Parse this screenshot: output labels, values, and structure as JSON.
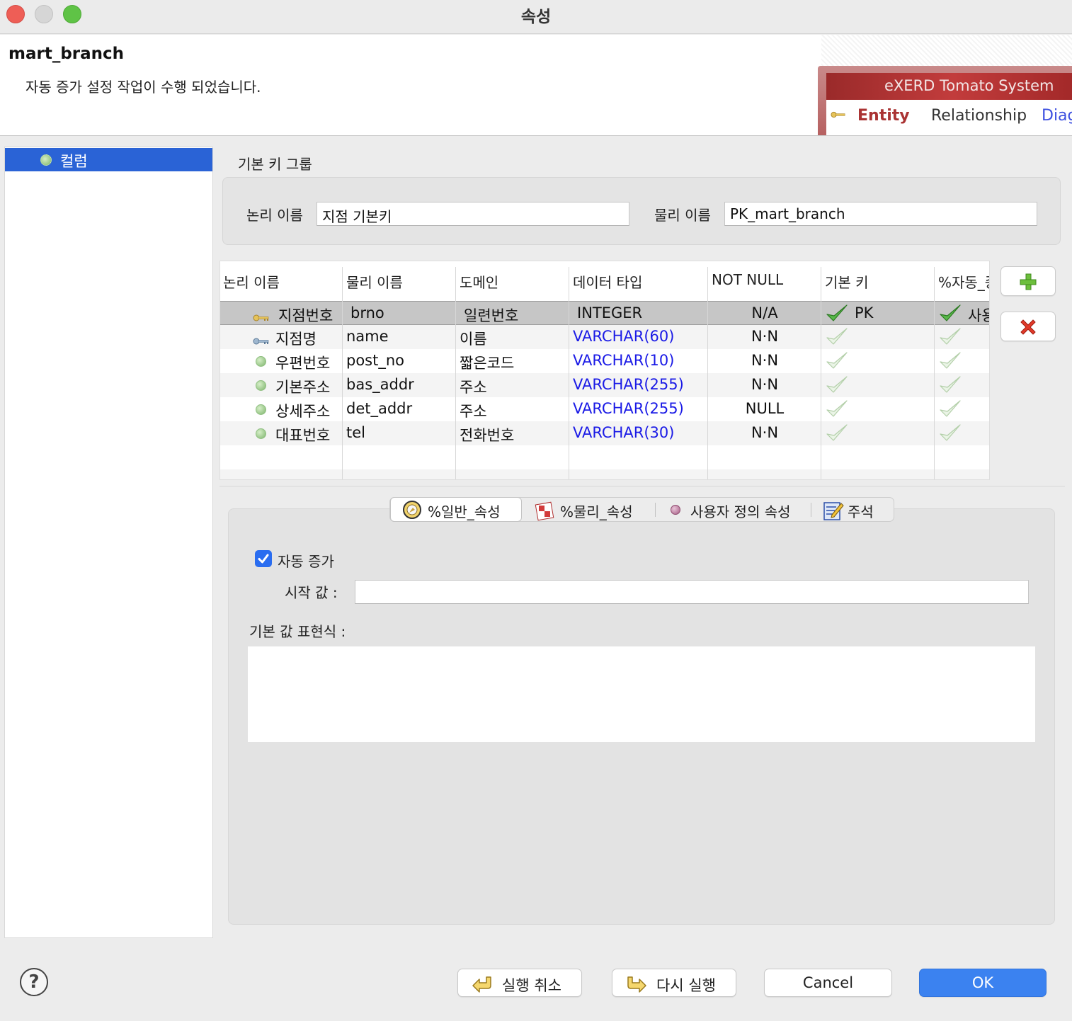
{
  "window": {
    "title": "속성"
  },
  "header": {
    "entity_name": "mart_branch",
    "message": "자동 증가 설정 작업이 수행 되었습니다.",
    "brand_title": "eXERD  Tomato System",
    "brand_tabs": [
      "Entity",
      "Relationship",
      "Diag"
    ]
  },
  "tree": {
    "items": [
      {
        "label": "컬럼",
        "icon": "column-icon"
      }
    ]
  },
  "pk_group": {
    "title": "기본 키 그룹",
    "logical_label": "논리 이름",
    "logical_value": "지점 기본키",
    "physical_label": "물리 이름",
    "physical_value": "PK_mart_branch"
  },
  "columns_table": {
    "headers": [
      "논리 이름",
      "물리 이름",
      "도메인",
      "데이터 타입",
      "NOT NULL",
      "기본 키",
      "%자동_증"
    ],
    "rows": [
      {
        "logical": "지점번호",
        "physical": "brno",
        "domain": "일련번호",
        "type": "INTEGER",
        "not_null": "N/A",
        "pk": "PK",
        "auto": "사용",
        "icon": "primary-key-icon",
        "selected": true
      },
      {
        "logical": "지점명",
        "physical": "name",
        "domain": "이름",
        "type": "VARCHAR(60)",
        "not_null": "N·N",
        "pk": "",
        "auto": "",
        "icon": "foreign-key-icon",
        "selected": false
      },
      {
        "logical": "우편번호",
        "physical": "post_no",
        "domain": "짧은코드",
        "type": "VARCHAR(10)",
        "not_null": "N·N",
        "pk": "",
        "auto": "",
        "icon": "column-dot-icon",
        "selected": false
      },
      {
        "logical": "기본주소",
        "physical": "bas_addr",
        "domain": "주소",
        "type": "VARCHAR(255)",
        "not_null": "N·N",
        "pk": "",
        "auto": "",
        "icon": "column-dot-icon",
        "selected": false
      },
      {
        "logical": "상세주소",
        "physical": "det_addr",
        "domain": "주소",
        "type": "VARCHAR(255)",
        "not_null": "NULL",
        "pk": "",
        "auto": "",
        "icon": "column-dot-icon",
        "selected": false
      },
      {
        "logical": "대표번호",
        "physical": "tel",
        "domain": "전화번호",
        "type": "VARCHAR(30)",
        "not_null": "N·N",
        "pk": "",
        "auto": "",
        "icon": "column-dot-icon",
        "selected": false
      }
    ]
  },
  "tabs": [
    {
      "label": "%일반_속성",
      "icon": "general-props-icon",
      "active": true
    },
    {
      "label": "%물리_속성",
      "icon": "physical-props-icon",
      "active": false
    },
    {
      "label": "사용자 정의 속성",
      "icon": "custom-props-icon",
      "active": false
    },
    {
      "label": "주석",
      "icon": "comment-icon",
      "active": false
    }
  ],
  "general": {
    "auto_increment_label": "자동 증가",
    "auto_increment_checked": true,
    "start_value_label": "시작 값 :",
    "start_value": "",
    "default_expr_label": "기본 값 표현식 :",
    "default_expr": ""
  },
  "footer": {
    "undo_label": "실행 취소",
    "redo_label": "다시 실행",
    "cancel_label": "Cancel",
    "ok_label": "OK"
  },
  "colors": {
    "accent": "#3b82f0",
    "selection": "#2a63d6",
    "type_text": "#1a1ae6"
  }
}
